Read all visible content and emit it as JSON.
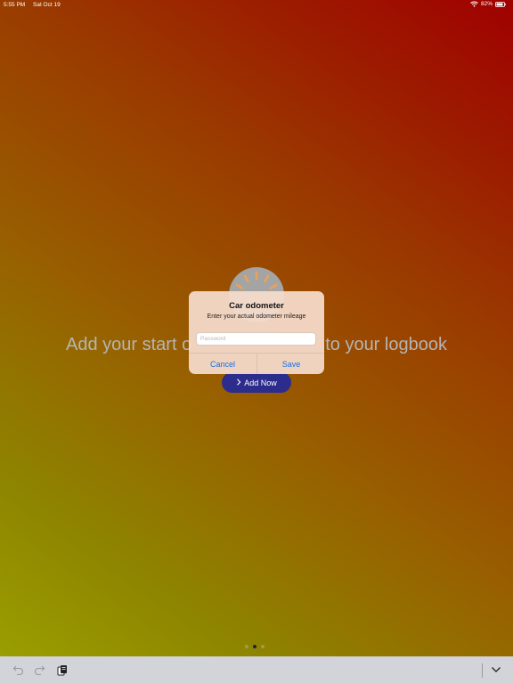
{
  "status_bar": {
    "time": "5:55 PM",
    "date": "Sat Oct 19",
    "battery": "82%"
  },
  "main": {
    "message_left": "Add your start o",
    "message_right": "to your logbook",
    "add_button_label": "Add Now",
    "add_button_icon": "chevron-right-icon",
    "background_icon": "speedometer-icon",
    "button_color": "#2c2c8c",
    "page_count": 3,
    "active_page": 2
  },
  "dialog": {
    "title": "Car odometer",
    "message": "Enter your actual odometer mileage",
    "input_value": "",
    "input_placeholder": "Password",
    "cancel_label": "Cancel",
    "save_label": "Save",
    "button_color": "#1a6fe0"
  },
  "toolbar": {
    "undo_icon": "undo-icon",
    "redo_icon": "redo-icon",
    "clipboard_icon": "clipboard-icon",
    "dismiss_icon": "chevron-down-icon"
  }
}
